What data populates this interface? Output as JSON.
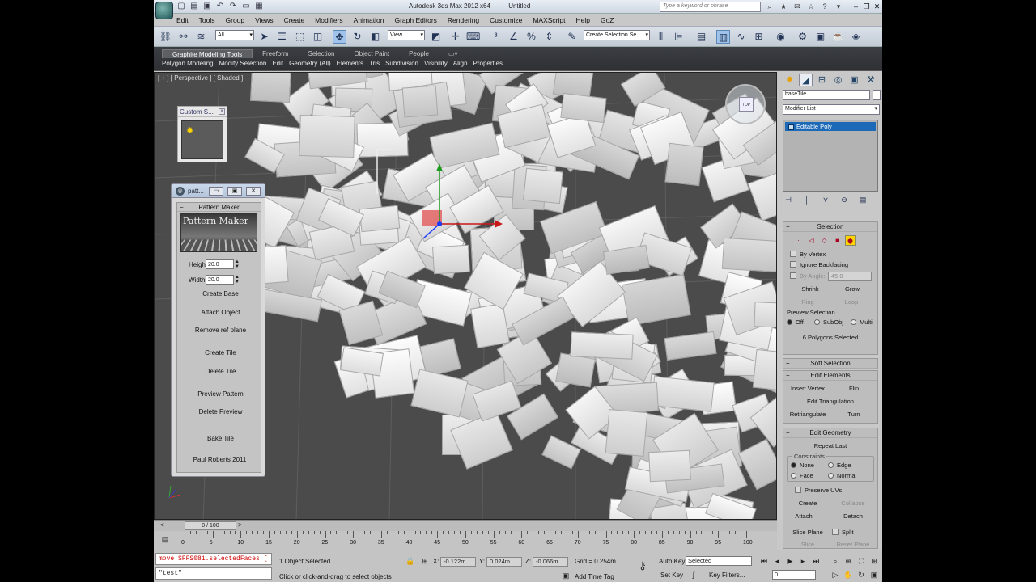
{
  "window": {
    "app_title": "Autodesk 3ds Max  2012 x64",
    "doc_title": "Untitled",
    "search_placeholder": "Type a keyword or phrase"
  },
  "menu": [
    "Edit",
    "Tools",
    "Group",
    "Views",
    "Create",
    "Modifiers",
    "Animation",
    "Graph Editors",
    "Rendering",
    "Customize",
    "MAXScript",
    "Help",
    "GoZ"
  ],
  "toolbar": {
    "selection_filter": "All",
    "ref_coord": "View",
    "named_selection": "Create Selection Se"
  },
  "ribbon": {
    "tabs": [
      "Graphite Modeling Tools",
      "Freeform",
      "Selection",
      "Object Paint",
      "People"
    ],
    "active_tab": 0,
    "subtabs": [
      "Polygon Modeling",
      "Modify Selection",
      "Edit",
      "Geometry (All)",
      "Elements",
      "Tris",
      "Subdivision",
      "Visibility",
      "Align",
      "Properties"
    ]
  },
  "viewport": {
    "label": "[ + ] [ Perspective ] [ Shaded ]",
    "viewcube_label": "TOP"
  },
  "custom_panel": {
    "title": "Custom S..."
  },
  "pattern_maker": {
    "window_title": "patt...",
    "rollout": "Pattern Maker",
    "banner": "Pattern Maker",
    "height_label": "Height",
    "height_value": "20.0",
    "width_label": "Width",
    "width_value": "20.0",
    "buttons": [
      "Create Base",
      "Attach Object",
      "Remove ref plane",
      "Create Tile",
      "Delete Tile",
      "Preview Pattern",
      "Delete Preview",
      "Bake Tile"
    ],
    "credit": "Paul Roberts 2011"
  },
  "command_panel": {
    "object_name": "baseTile",
    "modifier_list": "Modifier List",
    "stack_item": "Editable Poly",
    "selection": {
      "title": "Selection",
      "by_vertex": "By Vertex",
      "ignore_backfacing": "Ignore Backfacing",
      "by_angle": "By Angle:",
      "angle_value": "45.0",
      "shrink": "Shrink",
      "grow": "Grow",
      "ring": "Ring",
      "loop": "Loop",
      "preview_label": "Preview Selection",
      "off": "Off",
      "subobj": "SubObj",
      "multi": "Multi",
      "status": "6 Polygons Selected"
    },
    "soft_selection": "Soft Selection",
    "edit_elements": {
      "title": "Edit Elements",
      "insert_vertex": "Insert Vertex",
      "flip": "Flip",
      "edit_triangulation": "Edit Triangulation",
      "retriangulate": "Retriangulate",
      "turn": "Turn"
    },
    "edit_geometry": {
      "title": "Edit Geometry",
      "repeat_last": "Repeat Last",
      "constraints": "Constraints",
      "none": "None",
      "edge": "Edge",
      "face": "Face",
      "normal": "Normal",
      "preserve_uvs": "Preserve UVs",
      "create": "Create",
      "collapse": "Collapse",
      "attach": "Attach",
      "detach": "Detach",
      "slice_plane": "Slice Plane",
      "split": "Split",
      "slice": "Slice",
      "reset_plane": "Reset Plane"
    }
  },
  "timeline": {
    "frame": "0 / 100",
    "ticks": [
      "0",
      "5",
      "10",
      "15",
      "20",
      "25",
      "30",
      "35",
      "40",
      "45",
      "50",
      "55",
      "60",
      "65",
      "70",
      "75",
      "80",
      "85",
      "90",
      "95",
      "100"
    ]
  },
  "status": {
    "maxscript_line1": "move $FFS081.selectedFaces [",
    "maxscript_line2": "\"test\"",
    "selected": "1 Object Selected",
    "prompt": "Click or click-and-drag to select objects",
    "x_label": "X:",
    "x_value": "-0.122m",
    "y_label": "Y:",
    "y_value": "0.024m",
    "z_label": "Z:",
    "z_value": "-0.066m",
    "grid": "Grid = 0.254m",
    "add_time_tag": "Add Time Tag",
    "auto_key": "Auto Key",
    "set_key": "Set Key",
    "key_mode": "Selected",
    "key_filters": "Key Filters...",
    "current_frame": "0"
  }
}
